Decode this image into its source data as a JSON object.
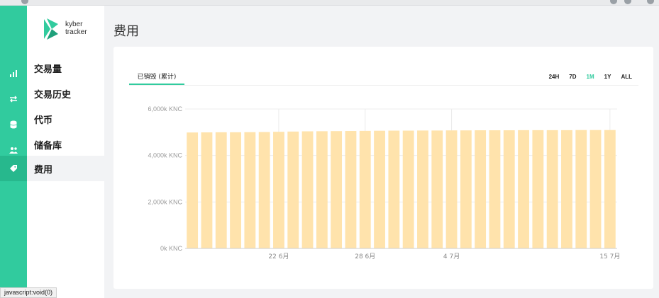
{
  "brand": {
    "line1": "kyber",
    "line2": "tracker",
    "color": "#31cb9e"
  },
  "page_title": "费用",
  "sidebar": {
    "items": [
      {
        "label": "交易量",
        "icon": "bar-chart-icon",
        "active": false
      },
      {
        "label": "交易历史",
        "icon": "exchange-arrows-icon",
        "active": false
      },
      {
        "label": "代币",
        "icon": "coins-stack-icon",
        "active": false
      },
      {
        "label": "储备库",
        "icon": "users-icon",
        "active": false
      },
      {
        "label": "费用",
        "icon": "tag-icon",
        "active": true
      }
    ]
  },
  "card": {
    "tab_label": "已销毁 (累计)",
    "ranges": [
      "24H",
      "7D",
      "1M",
      "1Y",
      "ALL"
    ],
    "active_range": "1M"
  },
  "chart_data": {
    "type": "bar",
    "title": "",
    "xlabel": "",
    "ylabel": "",
    "y_tick_labels": [
      "0k KNC",
      "2,000k KNC",
      "4,000k KNC",
      "6,000k KNC"
    ],
    "y_ticks": [
      0,
      2000,
      4000,
      6000
    ],
    "ylim": [
      0,
      6000
    ],
    "x_tick_labels": [
      "22 6月",
      "28 6月",
      "4 7月",
      "15 7月"
    ],
    "x_tick_indices": [
      6,
      12,
      18,
      29
    ],
    "bar_color": "#ffe3ac",
    "grid": true,
    "values": [
      4990,
      4995,
      5000,
      5000,
      5005,
      5010,
      5020,
      5030,
      5040,
      5045,
      5050,
      5055,
      5060,
      5065,
      5070,
      5070,
      5075,
      5075,
      5080,
      5080,
      5085,
      5085,
      5085,
      5090,
      5090,
      5090,
      5090,
      5095,
      5095,
      5095
    ]
  },
  "statusbar": {
    "text": "javascript:void(0)"
  }
}
